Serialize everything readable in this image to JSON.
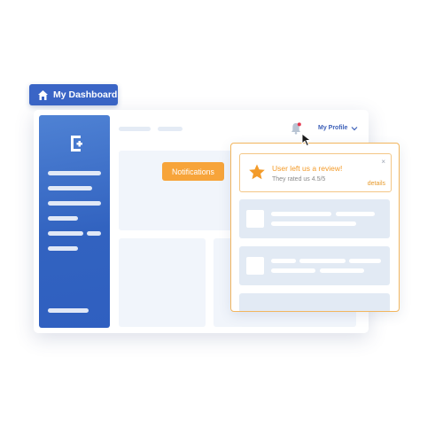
{
  "header": {
    "dashboard_label": "My Dashboard"
  },
  "top_bar": {
    "profile_label": "My Profile"
  },
  "main": {
    "notifications_button": "Notifications"
  },
  "popup": {
    "review": {
      "title": "User left us a review!",
      "subtitle": "They rated us 4.5/5",
      "details_link": "details",
      "close_glyph": "×"
    }
  },
  "icons": [
    "house-icon",
    "logo-icon",
    "bell-icon",
    "chevron-down-icon",
    "star-icon",
    "close-icon",
    "cursor-icon"
  ],
  "colors": {
    "brand_blue": "#3a65c6",
    "accent_orange": "#f7a43a",
    "notification_dot": "#e53950"
  }
}
